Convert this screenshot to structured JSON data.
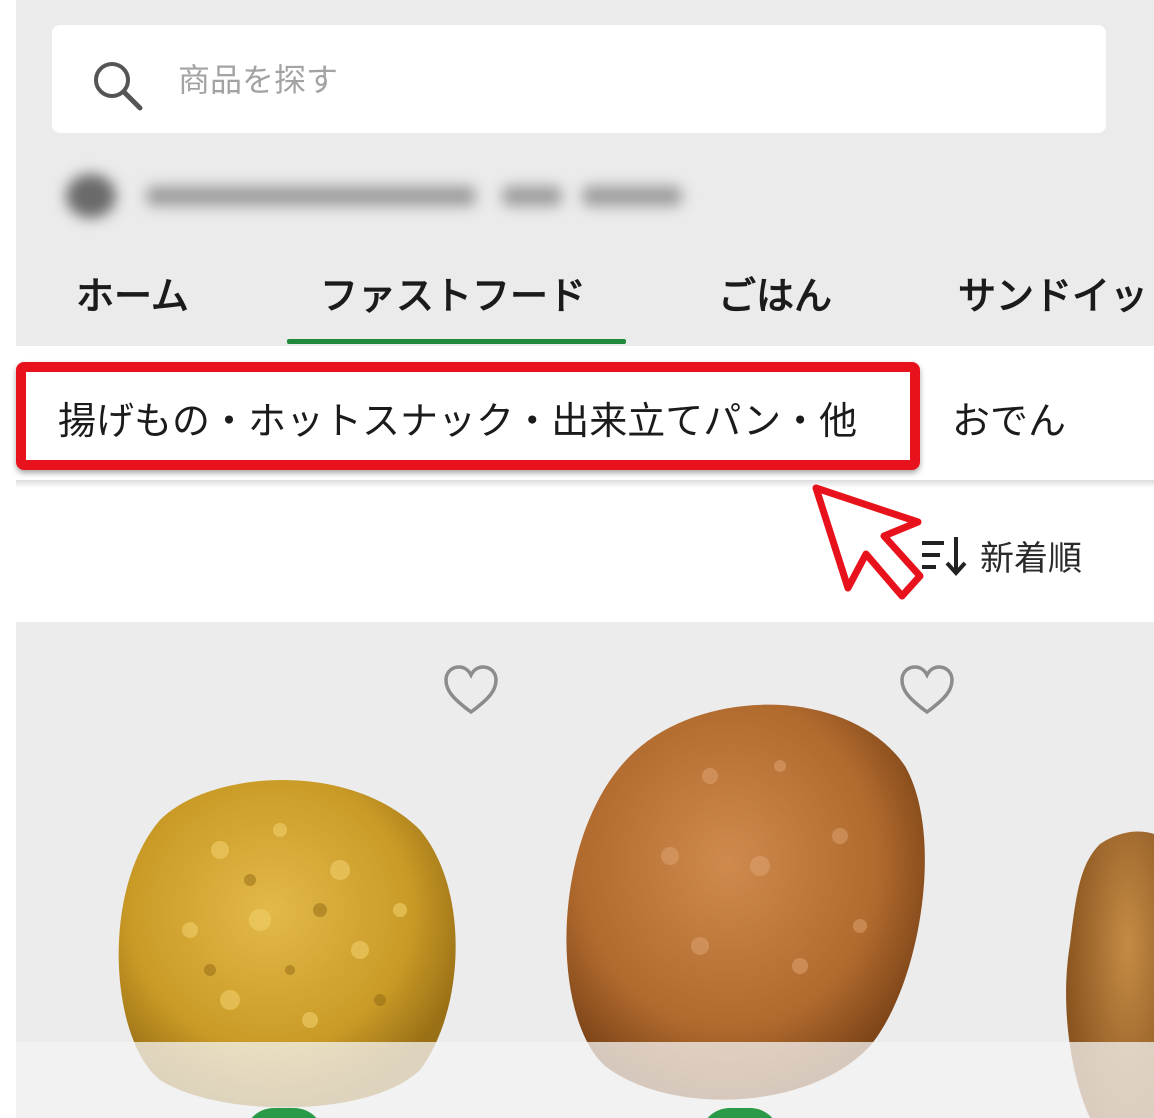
{
  "search": {
    "placeholder": "商品を探す"
  },
  "tabs": [
    {
      "label": "ホーム"
    },
    {
      "label": "ファストフード",
      "active": true
    },
    {
      "label": "ごはん"
    },
    {
      "label": "サンドイッ"
    }
  ],
  "subcategories": [
    {
      "label": "揚げもの・ホットスナック・出来立てパン・他",
      "highlighted": true
    },
    {
      "label": "おでん"
    }
  ],
  "sort": {
    "label": "新着順"
  },
  "colors": {
    "accent_green": "#1f8a3c",
    "highlight_red": "#e8121c"
  },
  "products": [
    {
      "name": "",
      "icon": "heart-icon"
    },
    {
      "name": "",
      "icon": "heart-icon"
    },
    {
      "name": ""
    }
  ]
}
